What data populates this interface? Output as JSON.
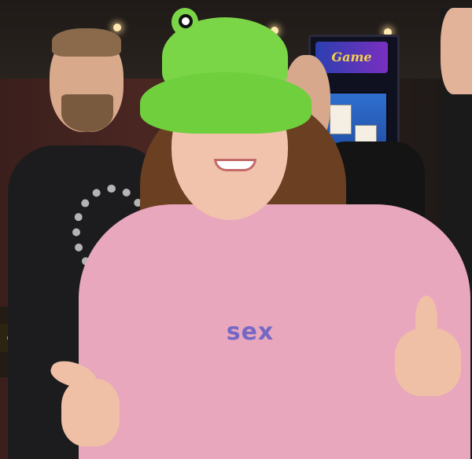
{
  "scene": {
    "arcade_sign_text": "Game",
    "left_sign_text": "Gol",
    "shirt_text": "sex"
  },
  "colors": {
    "hat": "#7ad647",
    "shirt": "#e9a7bd",
    "shirt_text": "#7568c4",
    "hair": "#6a3f22"
  }
}
